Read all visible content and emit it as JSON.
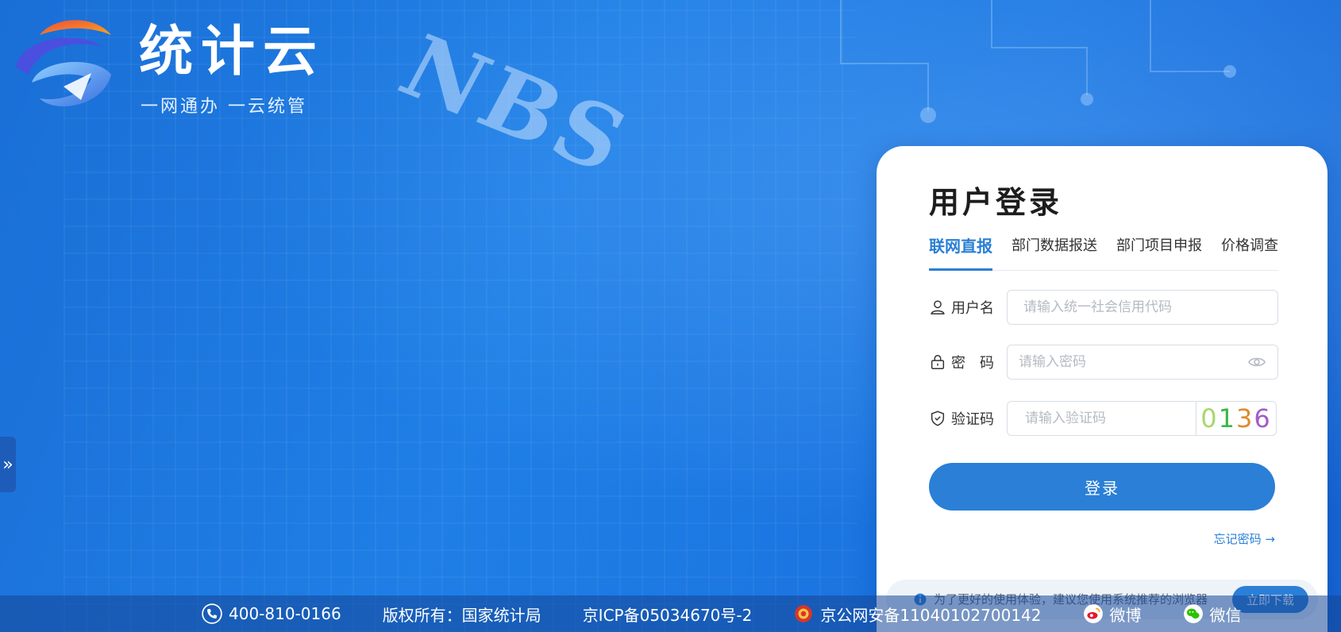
{
  "brand": {
    "title": "统计云",
    "slogan": "一网通办  一云统管"
  },
  "background": {
    "building_sign": "NBS"
  },
  "login": {
    "title": "用户登录",
    "tabs": [
      {
        "label": "联网直报",
        "active": true
      },
      {
        "label": "部门数据报送",
        "active": false
      },
      {
        "label": "部门项目申报",
        "active": false
      },
      {
        "label": "价格调查",
        "active": false
      }
    ],
    "username": {
      "label": "用户名",
      "placeholder": "请输入统一社会信用代码",
      "value": ""
    },
    "password": {
      "label": "密　码",
      "placeholder": "请输入密码",
      "value": ""
    },
    "captcha": {
      "label": "验证码",
      "placeholder": "请输入验证码",
      "value": "",
      "code": [
        "0",
        "1",
        "3",
        "6"
      ],
      "code_colors": [
        "#a6d86c",
        "#3bb54a",
        "#e08a2f",
        "#a35cc8"
      ]
    },
    "submit_label": "登录",
    "forgot_label": "忘记密码 →",
    "notice_text": "为了更好的使用体验，建议您使用系统推荐的浏览器",
    "notice_button": "立即下载"
  },
  "footer": {
    "phone": "400-810-0166",
    "copyright": "版权所有：国家统计局",
    "icp": "京ICP备05034670号-2",
    "police": "京公网安备11040102700142",
    "weibo": "微博",
    "wechat": "微信"
  },
  "colors": {
    "accent": "#2b7fd6",
    "background": "#1b74e0"
  }
}
